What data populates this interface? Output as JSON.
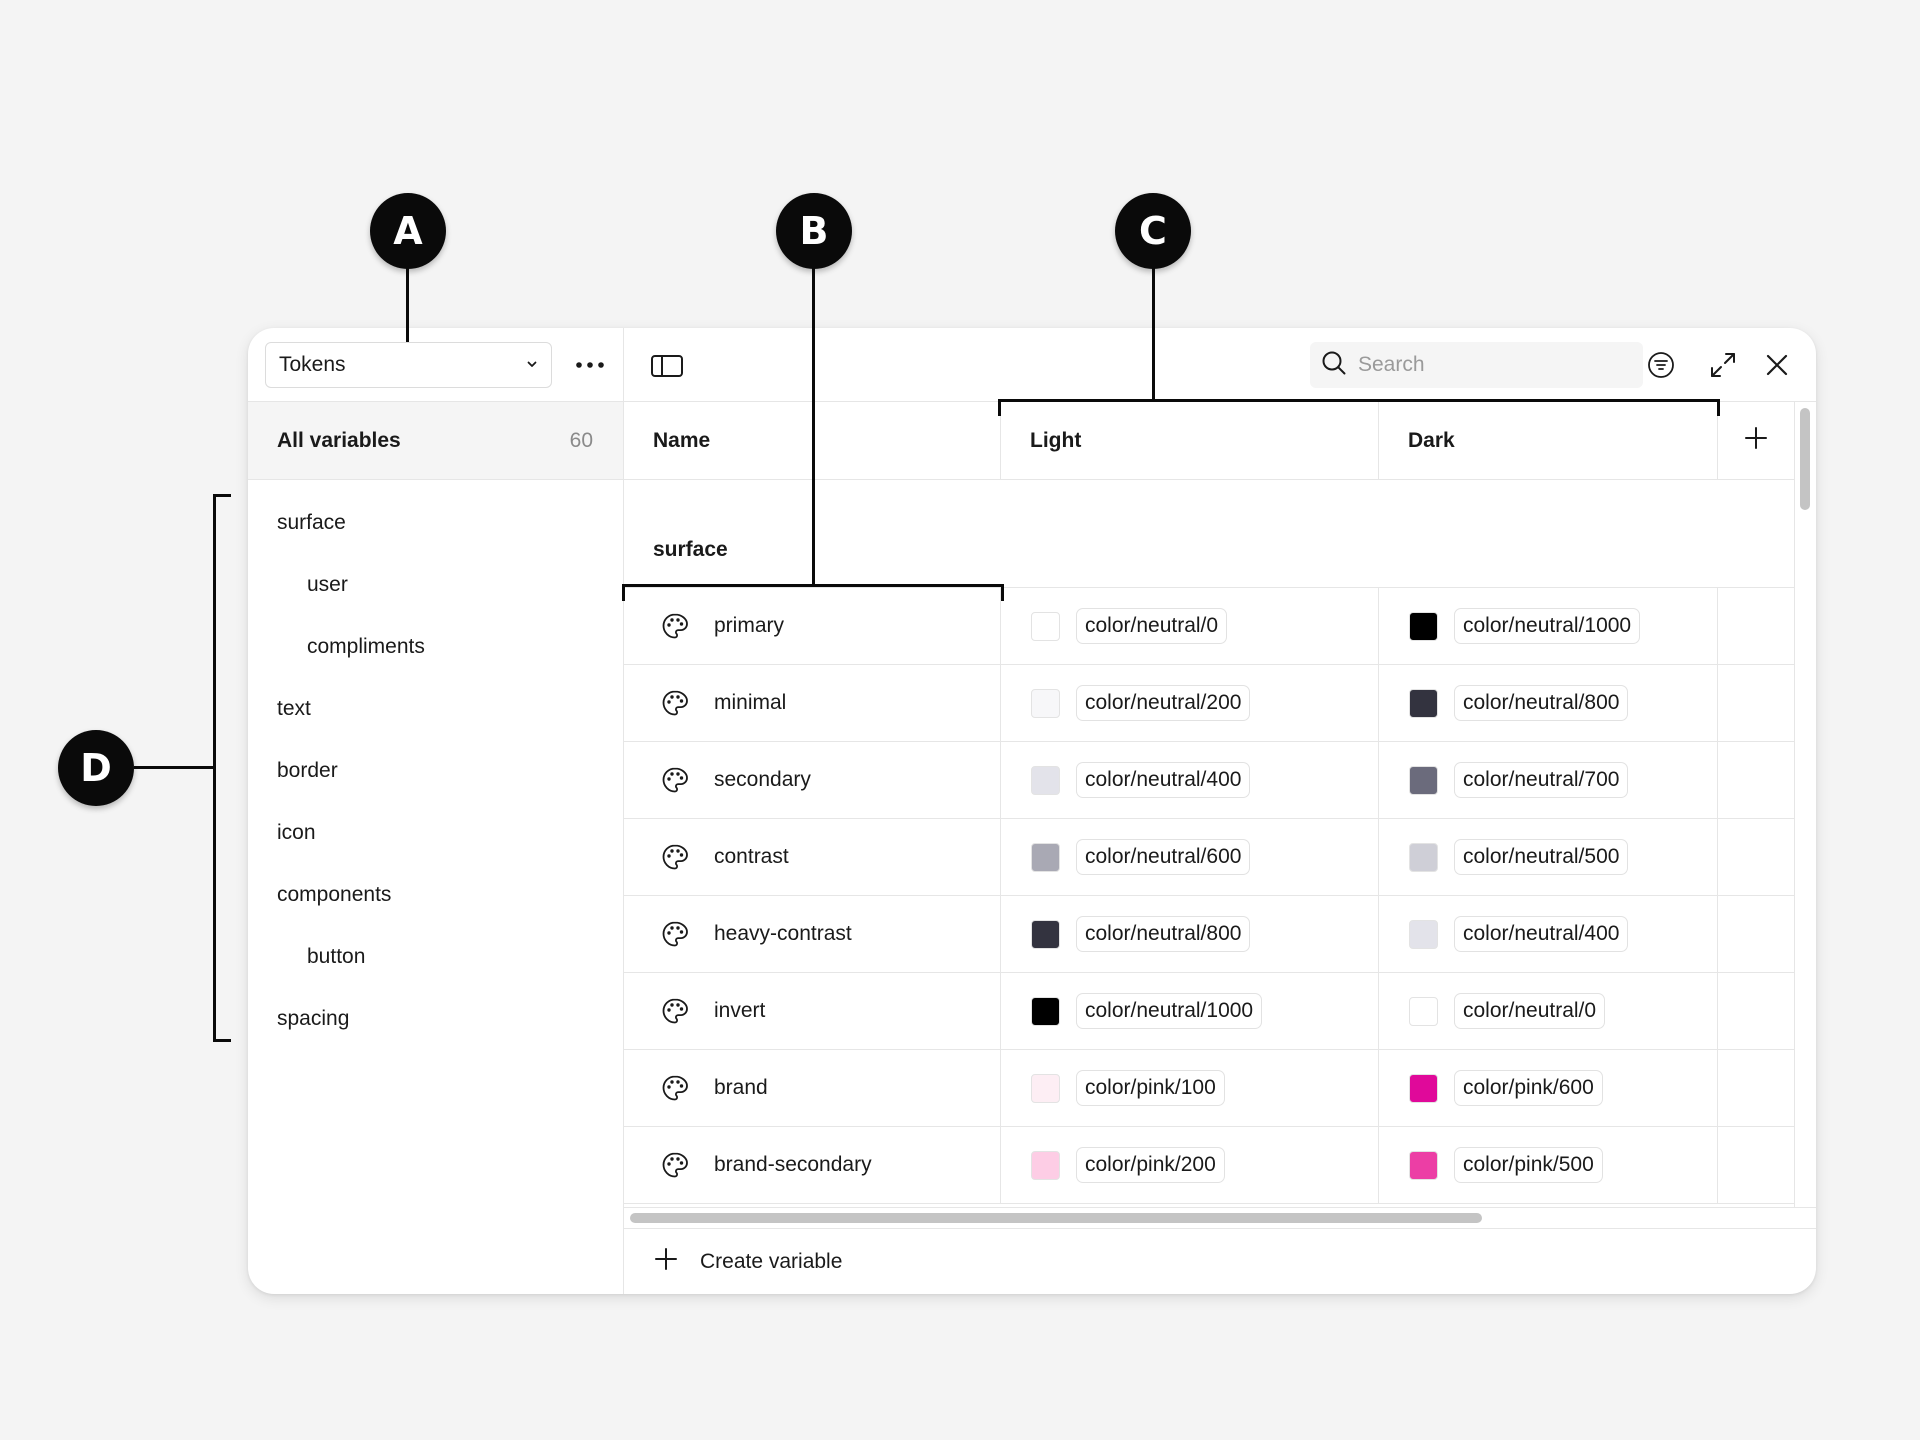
{
  "callouts": {
    "a": "A",
    "b": "B",
    "c": "C",
    "d": "D"
  },
  "sidebar": {
    "collection": "Tokens",
    "all_variables_label": "All variables",
    "all_variables_count": "60",
    "groups": [
      {
        "label": "surface",
        "indent": false
      },
      {
        "label": "user",
        "indent": true
      },
      {
        "label": "compliments",
        "indent": true
      },
      {
        "label": "text",
        "indent": false
      },
      {
        "label": "border",
        "indent": false
      },
      {
        "label": "icon",
        "indent": false
      },
      {
        "label": "components",
        "indent": false
      },
      {
        "label": "button",
        "indent": true
      },
      {
        "label": "spacing",
        "indent": false
      }
    ]
  },
  "search": {
    "placeholder": "Search"
  },
  "table": {
    "headers": {
      "name": "Name",
      "light": "Light",
      "dark": "Dark"
    },
    "group_title": "surface",
    "rows": [
      {
        "name": "primary",
        "light": {
          "alias": "color/neutral/0",
          "color": "#ffffff"
        },
        "dark": {
          "alias": "color/neutral/1000",
          "color": "#000000"
        }
      },
      {
        "name": "minimal",
        "light": {
          "alias": "color/neutral/200",
          "color": "#f7f7f9"
        },
        "dark": {
          "alias": "color/neutral/800",
          "color": "#33333f"
        }
      },
      {
        "name": "secondary",
        "light": {
          "alias": "color/neutral/400",
          "color": "#e3e3ea"
        },
        "dark": {
          "alias": "color/neutral/700",
          "color": "#6b6b7c"
        }
      },
      {
        "name": "contrast",
        "light": {
          "alias": "color/neutral/600",
          "color": "#a9a9b4"
        },
        "dark": {
          "alias": "color/neutral/500",
          "color": "#cfcfd7"
        }
      },
      {
        "name": "heavy-contrast",
        "light": {
          "alias": "color/neutral/800",
          "color": "#33333f"
        },
        "dark": {
          "alias": "color/neutral/400",
          "color": "#e3e3ea"
        }
      },
      {
        "name": "invert",
        "light": {
          "alias": "color/neutral/1000",
          "color": "#000000"
        },
        "dark": {
          "alias": "color/neutral/0",
          "color": "#ffffff"
        }
      },
      {
        "name": "brand",
        "light": {
          "alias": "color/pink/100",
          "color": "#fdeef4"
        },
        "dark": {
          "alias": "color/pink/600",
          "color": "#e0099a"
        }
      },
      {
        "name": "brand-secondary",
        "light": {
          "alias": "color/pink/200",
          "color": "#fdcde5"
        },
        "dark": {
          "alias": "color/pink/500",
          "color": "#ec3ea5"
        }
      }
    ]
  },
  "footer": {
    "create_label": "Create variable"
  }
}
